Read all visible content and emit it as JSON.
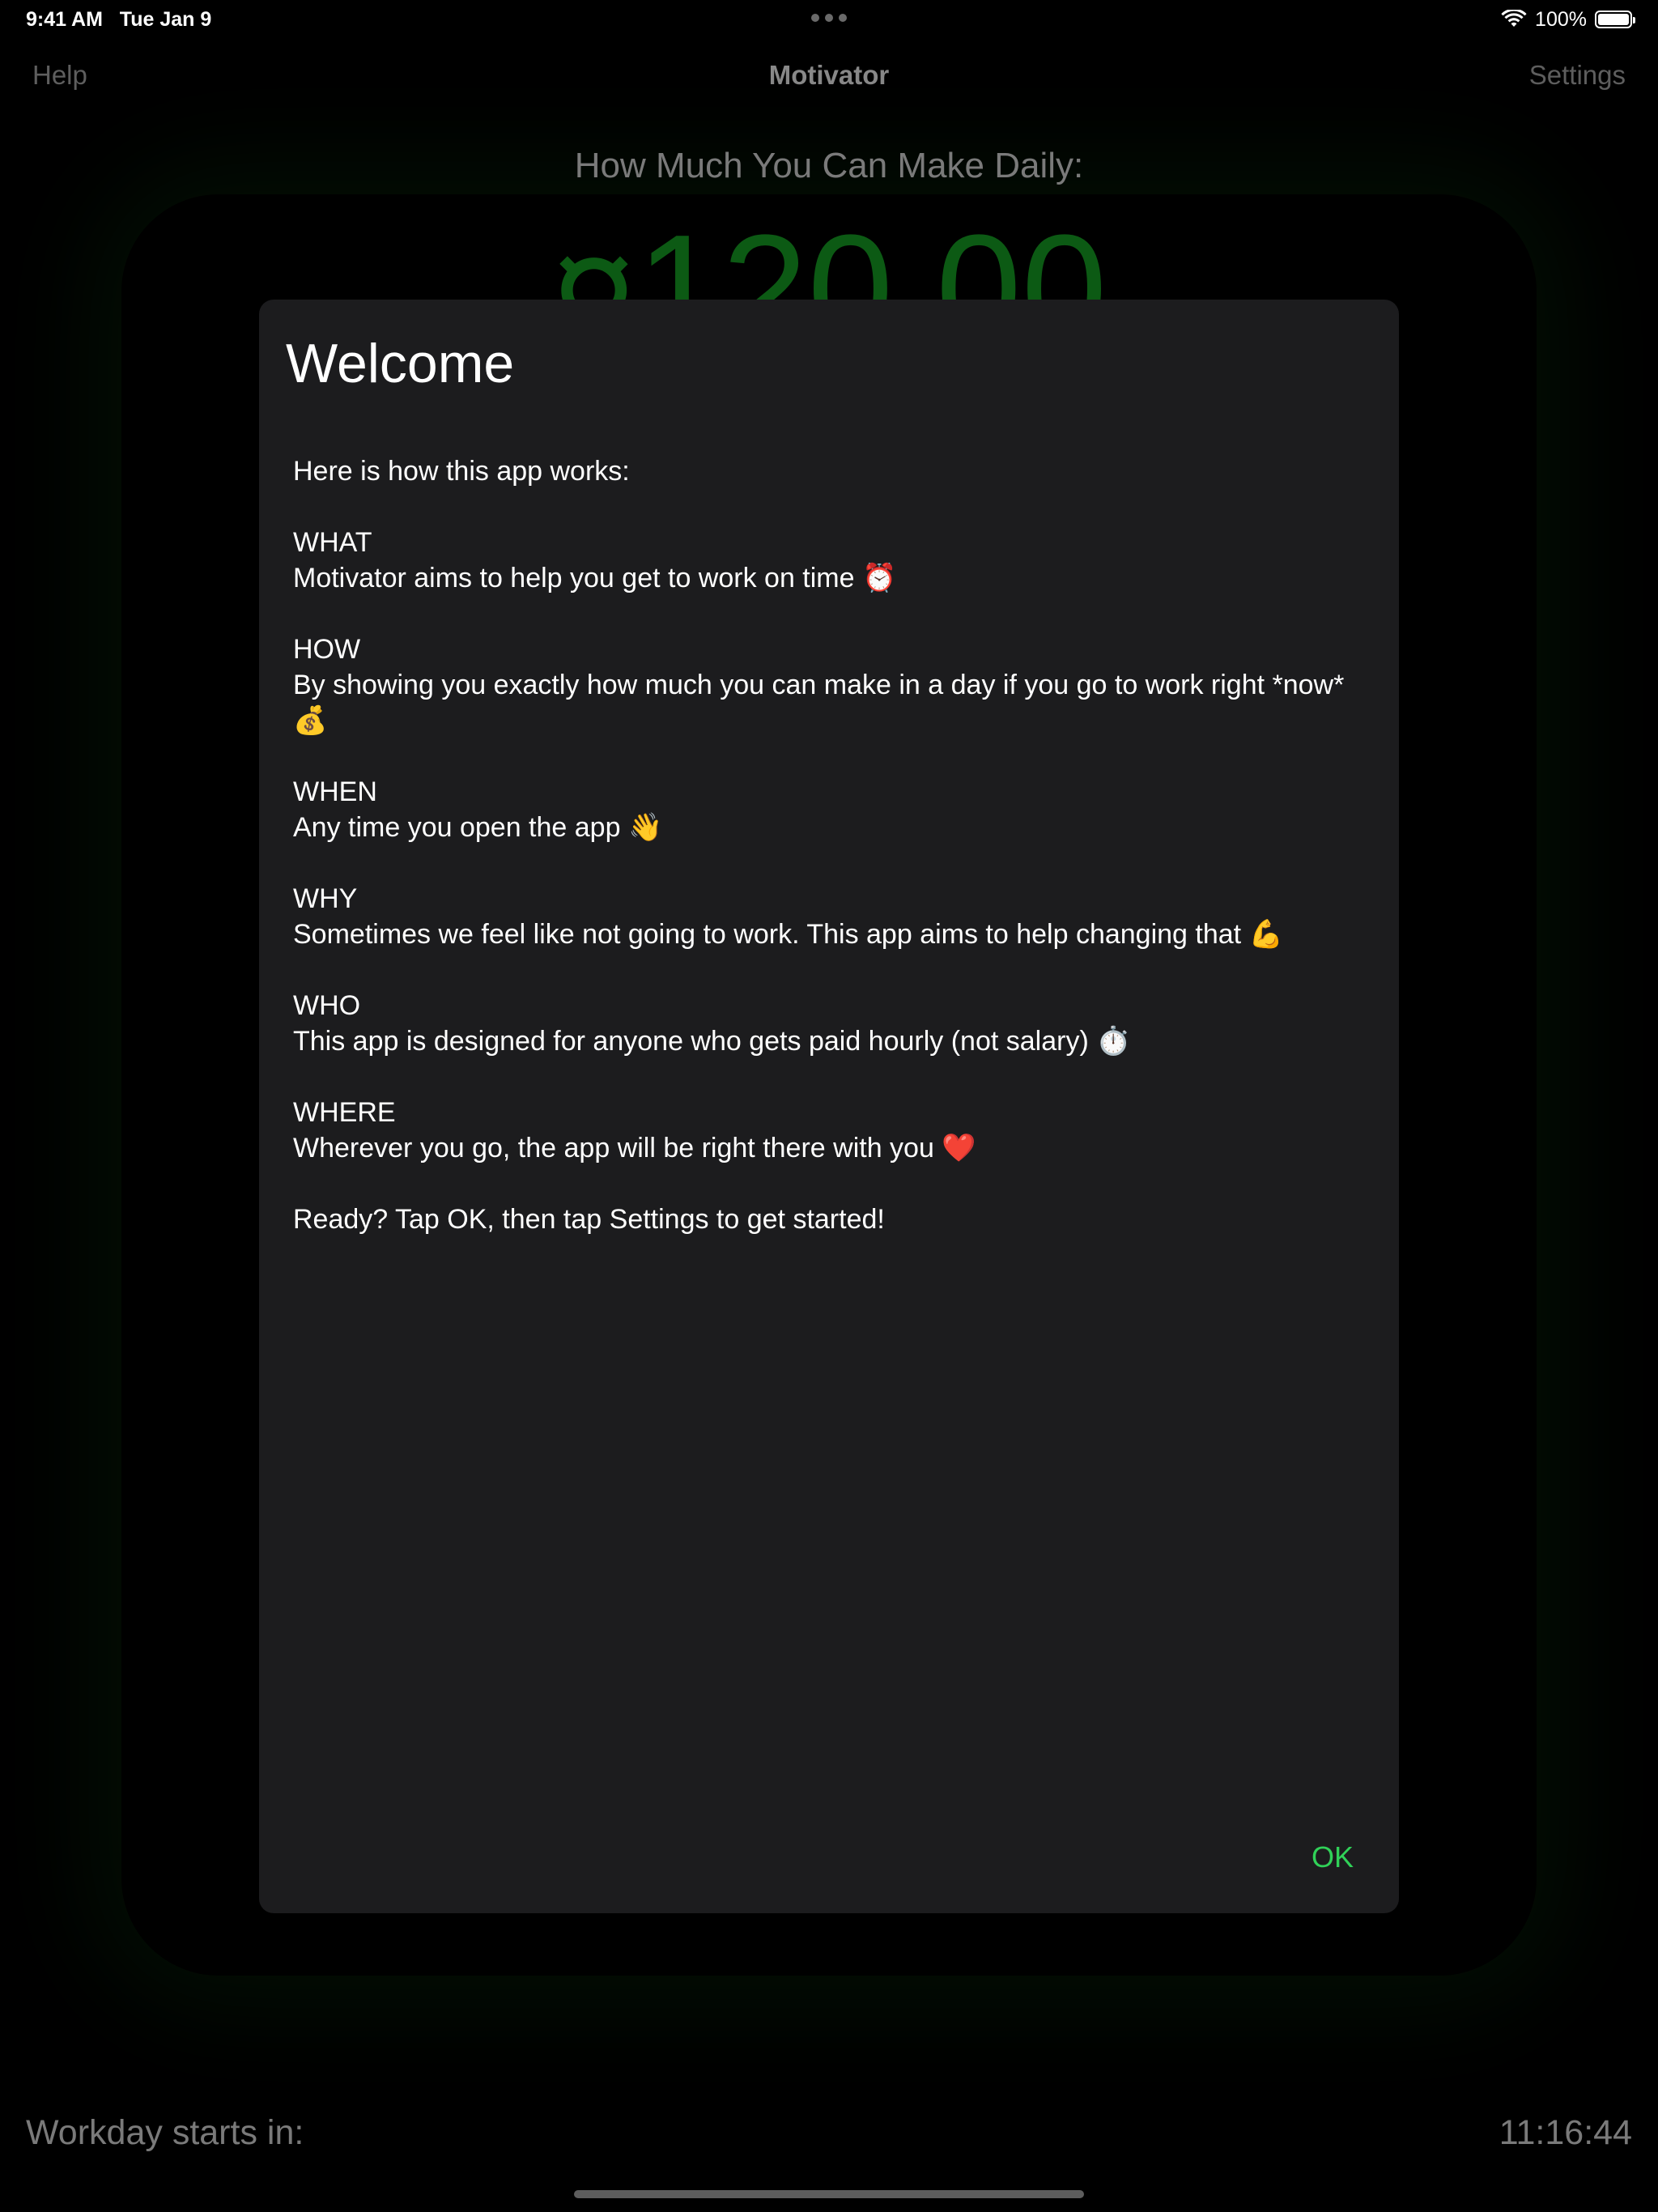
{
  "status_bar": {
    "time": "9:41 AM",
    "date": "Tue Jan 9",
    "battery": "100%",
    "wifi_icon": "wifi-icon",
    "battery_icon": "battery-icon"
  },
  "nav": {
    "left": "Help",
    "title": "Motivator",
    "right": "Settings"
  },
  "background": {
    "daily_label": "How Much You Can Make Daily:",
    "daily_amount": "¤120.00",
    "workday_label": "Workday starts in:",
    "workday_time": "11:16:44"
  },
  "dialog": {
    "title": "Welcome",
    "intro": "Here is how this app works:",
    "sections": [
      {
        "heading": "WHAT",
        "text": "Motivator aims to help you get to work on time ⏰"
      },
      {
        "heading": "HOW",
        "text": "By showing you exactly how much you can make in a day if you go to work right *now* 💰"
      },
      {
        "heading": "WHEN",
        "text": "Any time you open the app 👋"
      },
      {
        "heading": "WHY",
        "text": "Sometimes we feel like not going to work. This app aims to help changing that 💪"
      },
      {
        "heading": "WHO",
        "text": "This app is designed for anyone who gets paid hourly (not salary) ⏱️"
      },
      {
        "heading": "WHERE",
        "text": "Wherever you go, the app will be right there with you ❤️"
      }
    ],
    "outro": "Ready? Tap OK, then tap Settings to get started!",
    "ok_label": "OK"
  },
  "colors": {
    "accent_green": "#30d158",
    "amount_green": "#0c5a14",
    "dialog_bg": "#1c1c1e"
  }
}
